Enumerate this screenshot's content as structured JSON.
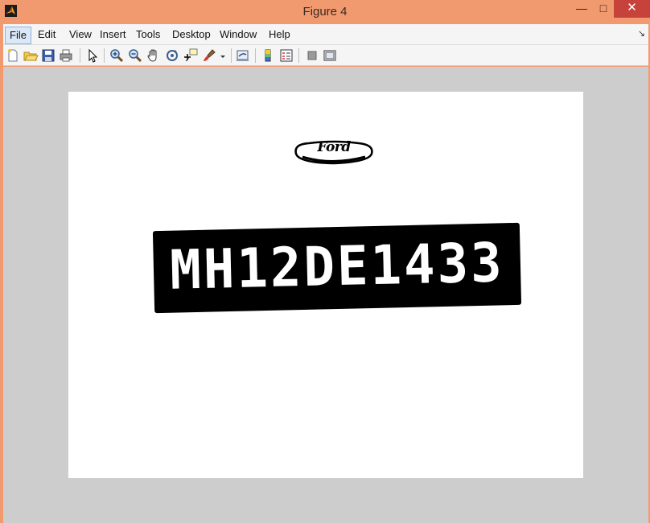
{
  "window": {
    "title": "Figure 4",
    "close_glyph": "✕",
    "min_glyph": "—",
    "max_glyph": "□"
  },
  "menu": {
    "items": [
      "File",
      "Edit",
      "View",
      "Insert",
      "Tools",
      "Desktop",
      "Window",
      "Help"
    ],
    "active": "File",
    "overflow_glyph": "↘"
  },
  "toolbar": {
    "icons": [
      "new-figure-icon",
      "open-icon",
      "save-icon",
      "print-icon",
      "edit-plot-icon",
      "zoom-in-icon",
      "zoom-out-icon",
      "pan-icon",
      "rotate-3d-icon",
      "data-cursor-icon",
      "brush-icon",
      "link-plot-icon",
      "colorbar-icon",
      "legend-icon",
      "hide-plot-tools-icon",
      "show-plot-tools-icon"
    ]
  },
  "figure": {
    "logo_text": "Ford",
    "plate_text": "MH12DE1433"
  },
  "colors": {
    "titlebar": "#f29a6f",
    "close": "#c7423a",
    "figure_bg": "#cdcdcd",
    "axes_bg": "#ffffff",
    "plate": "#000000"
  }
}
